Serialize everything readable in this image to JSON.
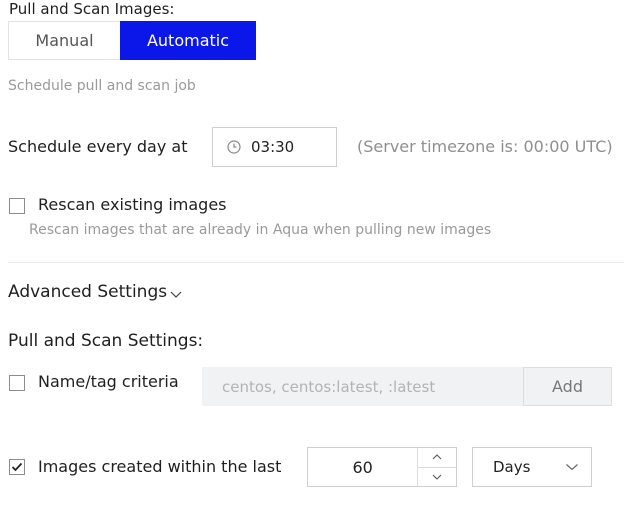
{
  "pull_scan": {
    "title": "Pull and Scan Images:",
    "modes": {
      "manual": "Manual",
      "automatic": "Automatic",
      "selected": "Automatic"
    },
    "schedule_subtitle": "Schedule pull and scan job",
    "schedule_label": "Schedule every day at",
    "schedule_time": "03:30",
    "timezone_note": "(Server timezone is: 00:00 UTC)",
    "rescan": {
      "label": "Rescan existing images",
      "description": "Rescan images that are already in Aqua when pulling new images",
      "checked": false
    }
  },
  "advanced": {
    "label": "Advanced Settings",
    "icon": "chevron-down-icon"
  },
  "settings": {
    "title": "Pull and Scan Settings:",
    "name_tag": {
      "label": "Name/tag criteria",
      "checked": false,
      "placeholder": "centos, centos:latest, :latest",
      "add_label": "Add"
    },
    "created_within": {
      "label": "Images created within the last",
      "checked": true,
      "value": "60",
      "unit": "Days"
    }
  },
  "colors": {
    "accent": "#0b17e8",
    "muted_text": "#9a9a9a",
    "input_bg": "#f1f2f4"
  }
}
